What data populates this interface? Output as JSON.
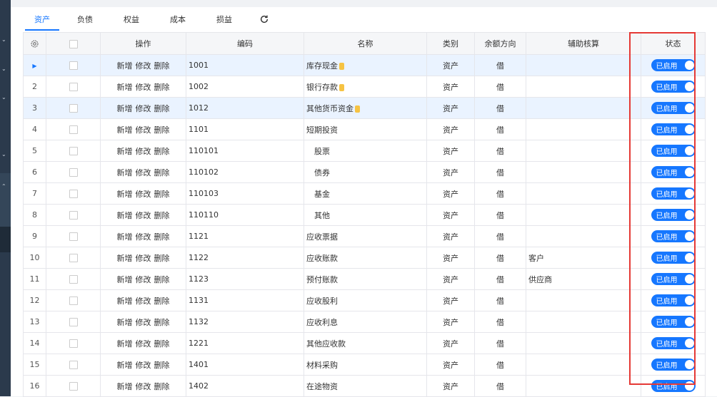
{
  "sidebar": {
    "chevrons": [
      "⌄",
      "⌄",
      "⌄",
      "⌄",
      "⌃"
    ]
  },
  "tabs": [
    "资产",
    "负债",
    "权益",
    "成本",
    "损益"
  ],
  "active_tab": "资产",
  "columns": [
    "操作",
    "编码",
    "名称",
    "类别",
    "余额方向",
    "辅助核算",
    "状态"
  ],
  "ops": [
    "新增",
    "修改",
    "删除"
  ],
  "rows": [
    {
      "no": "",
      "code": "1001",
      "name": "库存现金",
      "coin": true,
      "cat": "资产",
      "dir": "借",
      "aux": "",
      "status": "已启用",
      "hl": true,
      "arrow": "▶",
      "indent": false
    },
    {
      "no": "2",
      "code": "1002",
      "name": "银行存款",
      "coin": true,
      "cat": "资产",
      "dir": "借",
      "aux": "",
      "status": "已启用",
      "hl": false,
      "indent": false
    },
    {
      "no": "3",
      "code": "1012",
      "name": "其他货币资金",
      "coin": true,
      "cat": "资产",
      "dir": "借",
      "aux": "",
      "status": "已启用",
      "hl": true,
      "indent": false
    },
    {
      "no": "4",
      "code": "1101",
      "name": "短期投资",
      "coin": false,
      "cat": "资产",
      "dir": "借",
      "aux": "",
      "status": "已启用",
      "hl": false,
      "indent": false
    },
    {
      "no": "5",
      "code": "110101",
      "name": "股票",
      "coin": false,
      "cat": "资产",
      "dir": "借",
      "aux": "",
      "status": "已启用",
      "hl": false,
      "indent": true
    },
    {
      "no": "6",
      "code": "110102",
      "name": "债券",
      "coin": false,
      "cat": "资产",
      "dir": "借",
      "aux": "",
      "status": "已启用",
      "hl": false,
      "indent": true
    },
    {
      "no": "7",
      "code": "110103",
      "name": "基金",
      "coin": false,
      "cat": "资产",
      "dir": "借",
      "aux": "",
      "status": "已启用",
      "hl": false,
      "indent": true
    },
    {
      "no": "8",
      "code": "110110",
      "name": "其他",
      "coin": false,
      "cat": "资产",
      "dir": "借",
      "aux": "",
      "status": "已启用",
      "hl": false,
      "indent": true
    },
    {
      "no": "9",
      "code": "1121",
      "name": "应收票据",
      "coin": false,
      "cat": "资产",
      "dir": "借",
      "aux": "",
      "status": "已启用",
      "hl": false,
      "indent": false
    },
    {
      "no": "10",
      "code": "1122",
      "name": "应收账款",
      "coin": false,
      "cat": "资产",
      "dir": "借",
      "aux": "客户",
      "status": "已启用",
      "hl": false,
      "indent": false
    },
    {
      "no": "11",
      "code": "1123",
      "name": "预付账款",
      "coin": false,
      "cat": "资产",
      "dir": "借",
      "aux": "供应商",
      "status": "已启用",
      "hl": false,
      "indent": false
    },
    {
      "no": "12",
      "code": "1131",
      "name": "应收股利",
      "coin": false,
      "cat": "资产",
      "dir": "借",
      "aux": "",
      "status": "已启用",
      "hl": false,
      "indent": false
    },
    {
      "no": "13",
      "code": "1132",
      "name": "应收利息",
      "coin": false,
      "cat": "资产",
      "dir": "借",
      "aux": "",
      "status": "已启用",
      "hl": false,
      "indent": false
    },
    {
      "no": "14",
      "code": "1221",
      "name": "其他应收款",
      "coin": false,
      "cat": "资产",
      "dir": "借",
      "aux": "",
      "status": "已启用",
      "hl": false,
      "indent": false
    },
    {
      "no": "15",
      "code": "1401",
      "name": "材料采购",
      "coin": false,
      "cat": "资产",
      "dir": "借",
      "aux": "",
      "status": "已启用",
      "hl": false,
      "indent": false
    },
    {
      "no": "16",
      "code": "1402",
      "name": "在途物资",
      "coin": false,
      "cat": "资产",
      "dir": "借",
      "aux": "",
      "status": "已启用",
      "hl": false,
      "indent": false
    }
  ]
}
